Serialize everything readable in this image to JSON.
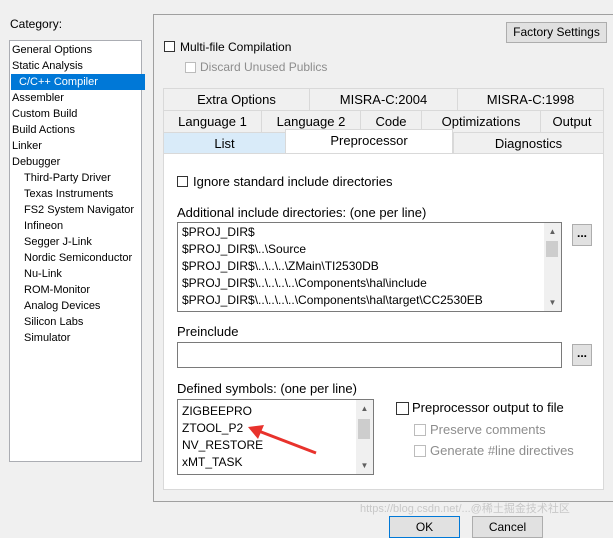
{
  "category": {
    "label": "Category:",
    "items": [
      {
        "label": "General Options",
        "indent": false
      },
      {
        "label": "Static Analysis",
        "indent": false
      },
      {
        "label": "C/C++ Compiler",
        "indent": false,
        "selected": true
      },
      {
        "label": "Assembler",
        "indent": false
      },
      {
        "label": "Custom Build",
        "indent": false
      },
      {
        "label": "Build Actions",
        "indent": false
      },
      {
        "label": "Linker",
        "indent": false
      },
      {
        "label": "Debugger",
        "indent": false
      },
      {
        "label": "Third-Party Driver",
        "indent": true
      },
      {
        "label": "Texas Instruments",
        "indent": true
      },
      {
        "label": "FS2 System Navigator",
        "indent": true
      },
      {
        "label": "Infineon",
        "indent": true
      },
      {
        "label": "Segger J-Link",
        "indent": true
      },
      {
        "label": "Nordic Semiconductor",
        "indent": true
      },
      {
        "label": "Nu-Link",
        "indent": true
      },
      {
        "label": "ROM-Monitor",
        "indent": true
      },
      {
        "label": "Analog Devices",
        "indent": true
      },
      {
        "label": "Silicon Labs",
        "indent": true
      },
      {
        "label": "Simulator",
        "indent": true
      }
    ]
  },
  "header": {
    "factory_settings": "Factory Settings",
    "multi_file": "Multi-file Compilation",
    "discard_unused": "Discard Unused Publics"
  },
  "tabs": {
    "row1": [
      "Extra Options",
      "MISRA-C:2004",
      "MISRA-C:1998"
    ],
    "row2": [
      "Language 1",
      "Language 2",
      "Code",
      "Optimizations",
      "Output"
    ],
    "row3": [
      "List",
      "Preprocessor",
      "Diagnostics"
    ]
  },
  "preprocessor": {
    "ignore_std": "Ignore standard include directories",
    "include_label": "Additional include directories: (one per line)",
    "include_dirs": [
      "$PROJ_DIR$",
      "$PROJ_DIR$\\..\\Source",
      "$PROJ_DIR$\\..\\..\\..\\ZMain\\TI2530DB",
      "$PROJ_DIR$\\..\\..\\..\\..\\Components\\hal\\include",
      "$PROJ_DIR$\\..\\..\\..\\..\\Components\\hal\\target\\CC2530EB"
    ],
    "browse_button": "...",
    "preinclude_label": "Preinclude",
    "preinclude_value": "",
    "defined_label": "Defined symbols: (one per line)",
    "defined_symbols": [
      "ZIGBEEPRO",
      "ZTOOL_P2",
      "NV_RESTORE",
      "xMT_TASK"
    ],
    "output_to_file": "Preprocessor output to file",
    "preserve_comments": "Preserve comments",
    "generate_line": "Generate #line directives"
  },
  "footer": {
    "ok": "OK",
    "cancel": "Cancel"
  },
  "annotation_color": "#e8322c",
  "accent_color": "#0078d7",
  "watermark": "https://blog.csdn.net/...@稀土掘金技术社区"
}
